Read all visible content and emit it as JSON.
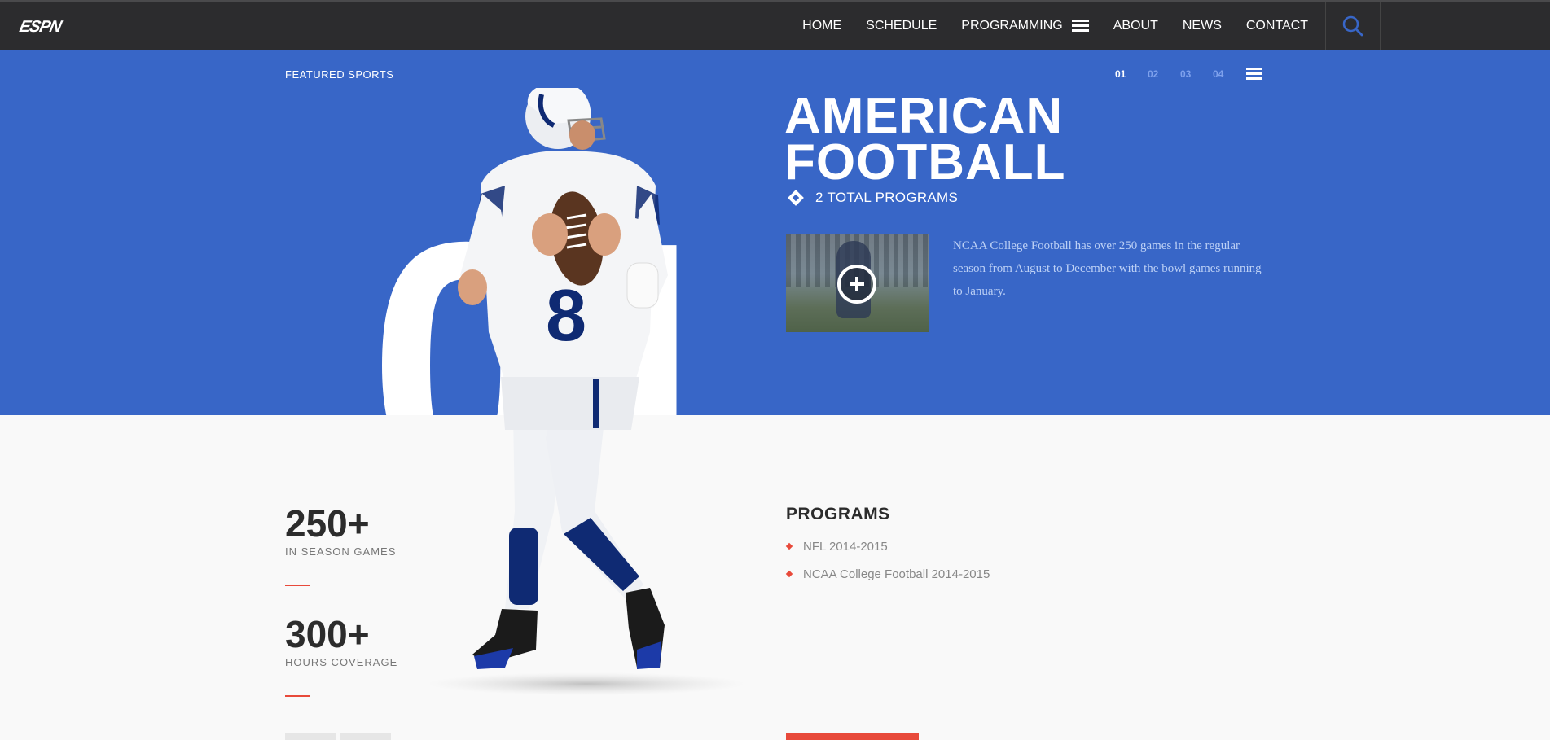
{
  "nav": {
    "logo": "ESPN",
    "items": [
      "HOME",
      "SCHEDULE",
      "PROGRAMMING",
      "ABOUT",
      "NEWS",
      "CONTACT"
    ]
  },
  "subbar": {
    "label": "FEATURED SPORTS",
    "pages": [
      "01",
      "02",
      "03",
      "04"
    ],
    "active_page": "01"
  },
  "hero": {
    "big_number": "01",
    "title_line1": "AMERICAN",
    "title_line2": "FOOTBALL",
    "total_programs": "2 TOTAL PROGRAMS",
    "description": "NCAA College Football has over 250 games in the regular season from August to December with the bowl games running to January."
  },
  "stats": [
    {
      "value": "250+",
      "label": "IN SEASON GAMES"
    },
    {
      "value": "300+",
      "label": "HOURS COVERAGE"
    }
  ],
  "programs": {
    "title": "PROGRAMS",
    "items": [
      "NFL 2014-2015",
      "NCAA College Football 2014-2015"
    ]
  },
  "colors": {
    "hero_blue": "#3866c7",
    "nav_dark": "#2c2c2e",
    "accent_red": "#e84a3b"
  },
  "icons": [
    "search-icon",
    "menu-icon",
    "plus-icon",
    "diamond-icon"
  ]
}
